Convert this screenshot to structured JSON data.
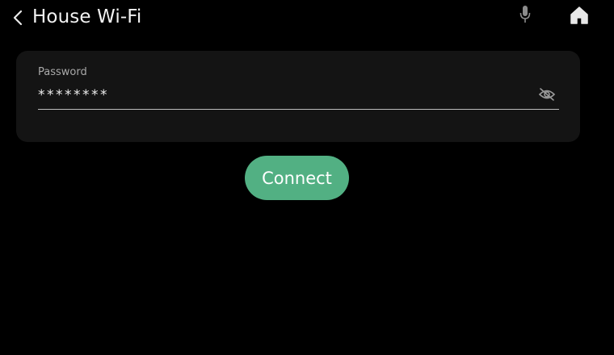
{
  "header": {
    "title": "House Wi-Fi",
    "back_icon": "chevron-left-icon",
    "mic_icon": "microphone-icon",
    "home_icon": "home-icon"
  },
  "password_card": {
    "label": "Password",
    "value": "********",
    "visibility_icon": "eye-off-icon"
  },
  "connect_button": {
    "label": "Connect",
    "color": "#52b083"
  },
  "colors": {
    "background": "#000000",
    "card": "#141414",
    "accent": "#52b083"
  }
}
